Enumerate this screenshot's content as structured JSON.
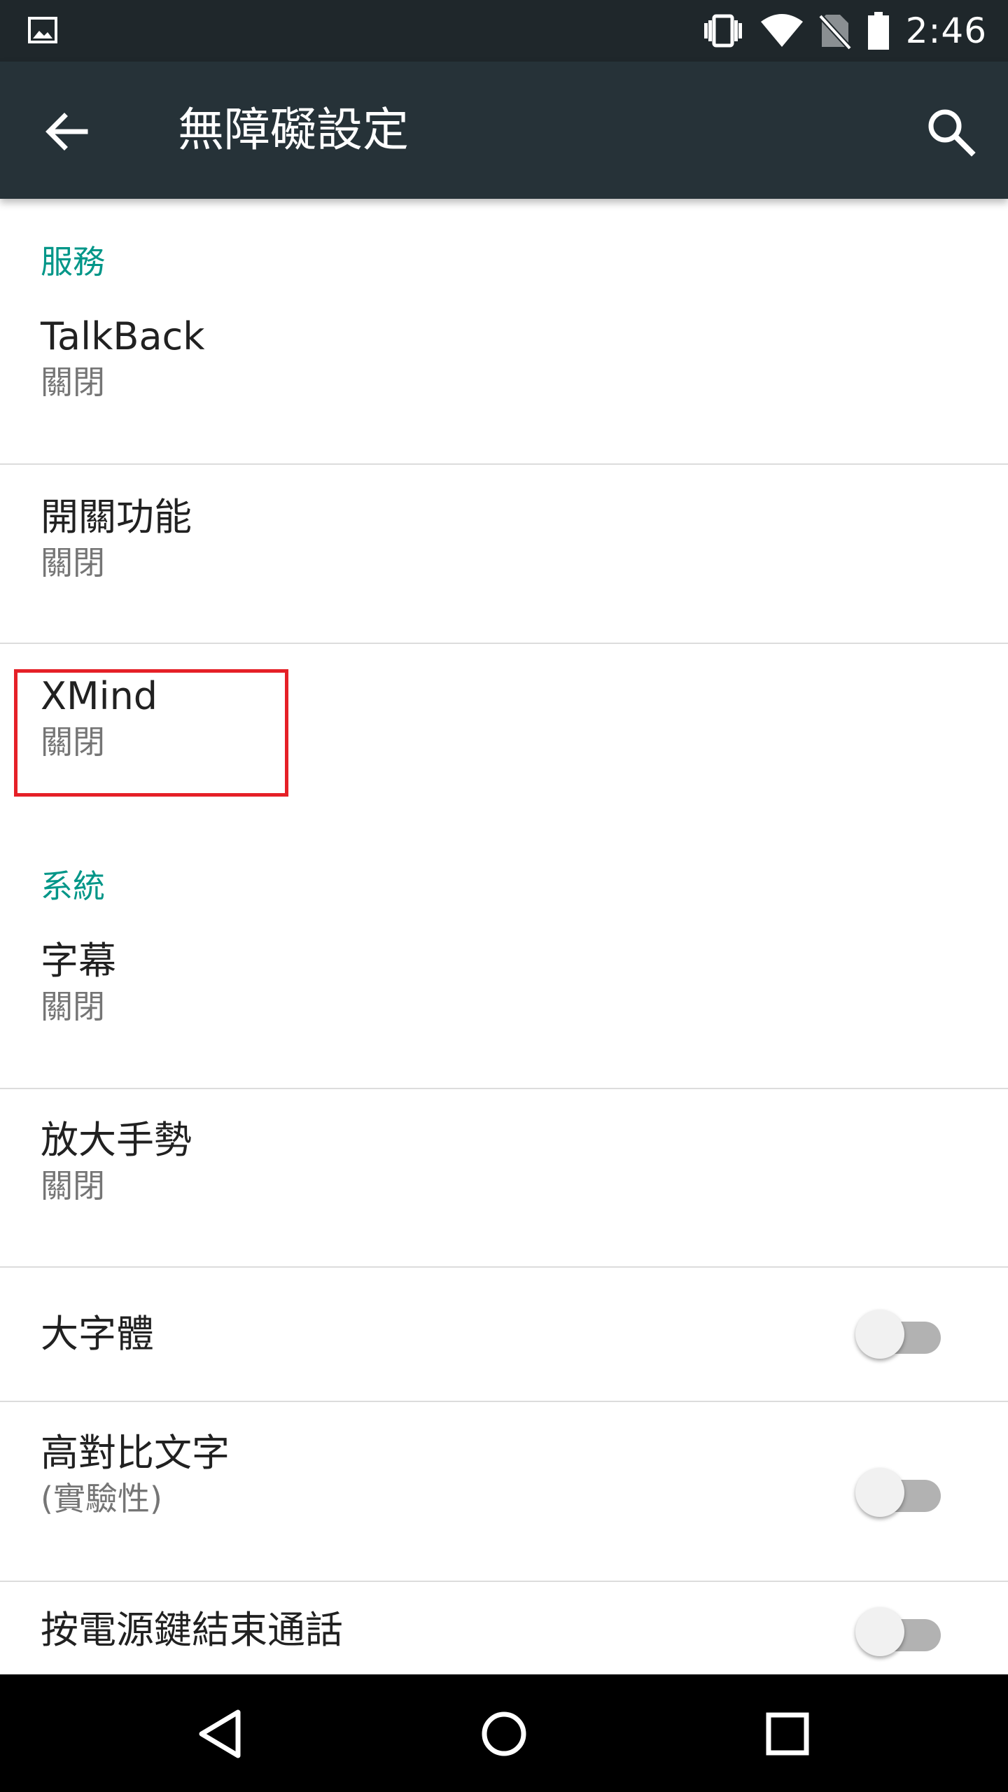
{
  "status_bar": {
    "time": "2:46",
    "icons": [
      "image-icon",
      "vibrate-icon",
      "wifi-icon",
      "no-sim-icon",
      "battery-icon"
    ]
  },
  "app_bar": {
    "title": "無障礙設定",
    "icons": [
      "back-arrow-icon",
      "search-icon"
    ]
  },
  "sections": {
    "services": {
      "header": "服務",
      "items": [
        {
          "title": "TalkBack",
          "status": "關閉"
        },
        {
          "title": "開關功能",
          "status": "關閉"
        },
        {
          "title": "XMind",
          "status": "關閉"
        }
      ]
    },
    "system": {
      "header": "系統",
      "items": [
        {
          "title": "字幕",
          "status": "關閉"
        },
        {
          "title": "放大手勢",
          "status": "關閉"
        },
        {
          "title": "大字體",
          "toggle_on": false
        },
        {
          "title": "高對比文字",
          "subtitle": "(實驗性)",
          "toggle_on": false
        },
        {
          "title": "按電源鍵結束通話",
          "toggle_on": false
        }
      ]
    }
  },
  "nav_bar": {
    "icons": [
      "back-triangle-icon",
      "home-circle-icon",
      "recents-square-icon"
    ]
  },
  "colors": {
    "accent": "#009688",
    "app_bar": "#263238",
    "status_bar": "#1f272b",
    "highlight": "#e52027"
  }
}
